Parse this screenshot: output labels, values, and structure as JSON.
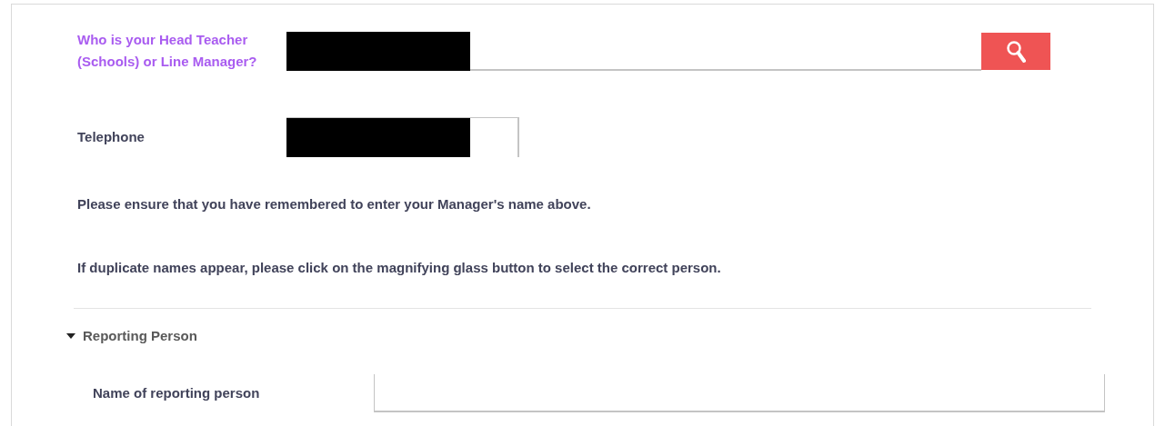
{
  "fields": [
    {
      "label": "Who is your Head Teacher (Schools) or Line Manager?",
      "highlighted": true,
      "redacted": true,
      "kind": "lookup"
    },
    {
      "label": "Telephone",
      "highlighted": false,
      "redacted": true,
      "kind": "short"
    }
  ],
  "notes": [
    "Please ensure that you have remembered to enter your Manager's name above.",
    "If duplicate names appear, please click on the magnifying glass button to select the correct person."
  ],
  "section": {
    "title": "Reporting Person",
    "expanded": true,
    "fields": [
      {
        "label": "Name of reporting person"
      }
    ]
  }
}
